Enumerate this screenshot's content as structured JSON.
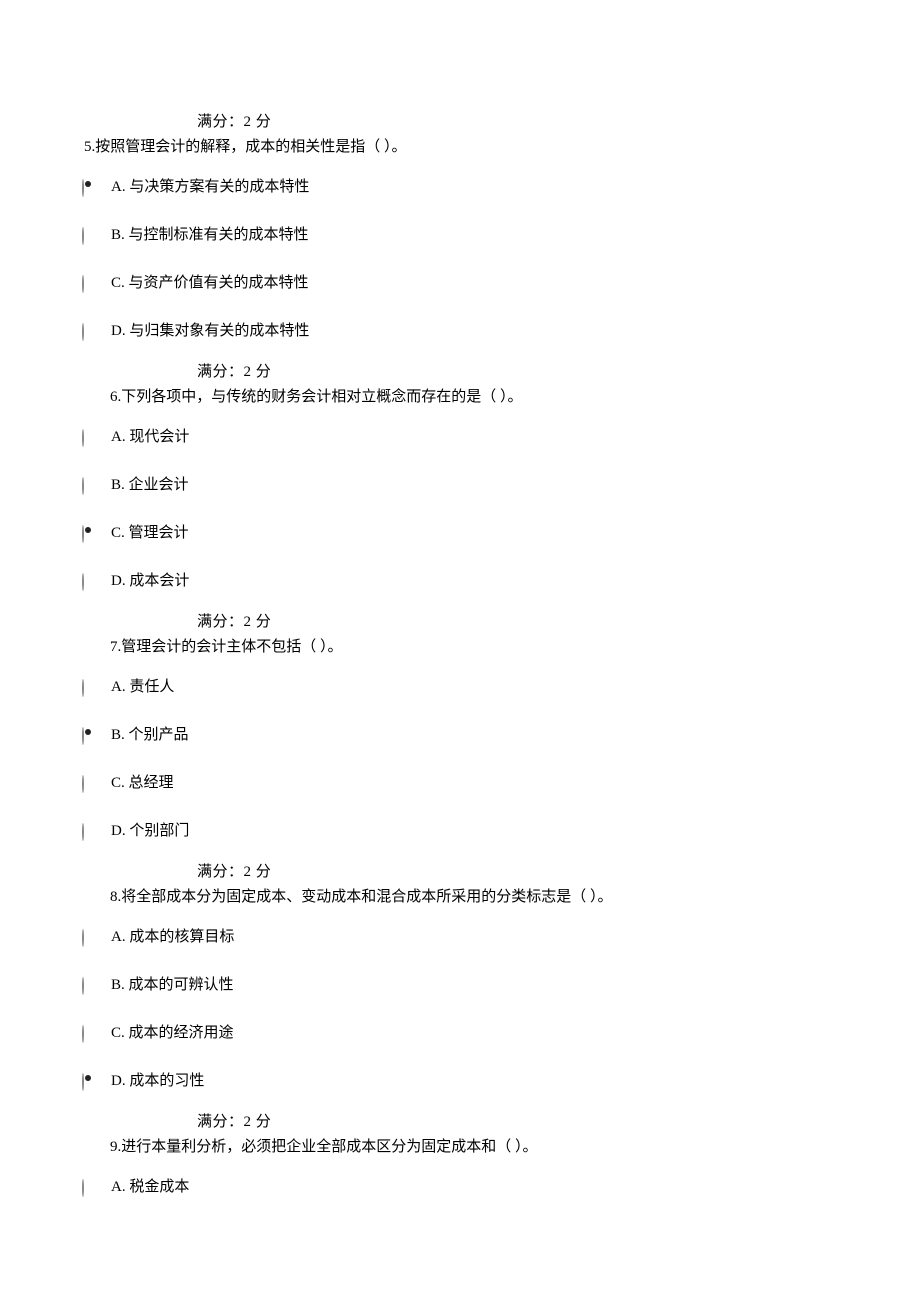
{
  "score_label": "满分：2    分",
  "questions": [
    {
      "num": "5.  ",
      "text": "按照管理会计的解释，成本的相关性是指（   ）。",
      "indent_class": "question-line-5",
      "options": [
        "A. 与决策方案有关的成本特性",
        "B. 与控制标准有关的成本特性",
        "C. 与资产价值有关的成本特性",
        "D. 与归集对象有关的成本特性"
      ],
      "selected": 0
    },
    {
      "num": "6.   ",
      "text": "下列各项中，与传统的财务会计相对立概念而存在的是（   ）。",
      "indent_class": "question-line",
      "options": [
        "A. 现代会计",
        "B. 企业会计",
        "C. 管理会计",
        "D. 成本会计"
      ],
      "selected": 2
    },
    {
      "num": "7.   ",
      "text": "管理会计的会计主体不包括（   ）。",
      "indent_class": "question-line",
      "options": [
        "A. 责任人",
        "B. 个别产品",
        "C. 总经理",
        "D. 个别部门"
      ],
      "selected": 1
    },
    {
      "num": "8.   ",
      "text": "将全部成本分为固定成本、变动成本和混合成本所采用的分类标志是（   ）。",
      "indent_class": "question-line",
      "options": [
        "A. 成本的核算目标",
        "B. 成本的可辨认性",
        "C. 成本的经济用途",
        "D. 成本的习性"
      ],
      "selected": 3
    },
    {
      "num": "9.   ",
      "text": "进行本量利分析，必须把企业全部成本区分为固定成本和（   ）。",
      "indent_class": "question-line",
      "options": [
        "A. 税金成本"
      ],
      "selected": -1
    }
  ]
}
